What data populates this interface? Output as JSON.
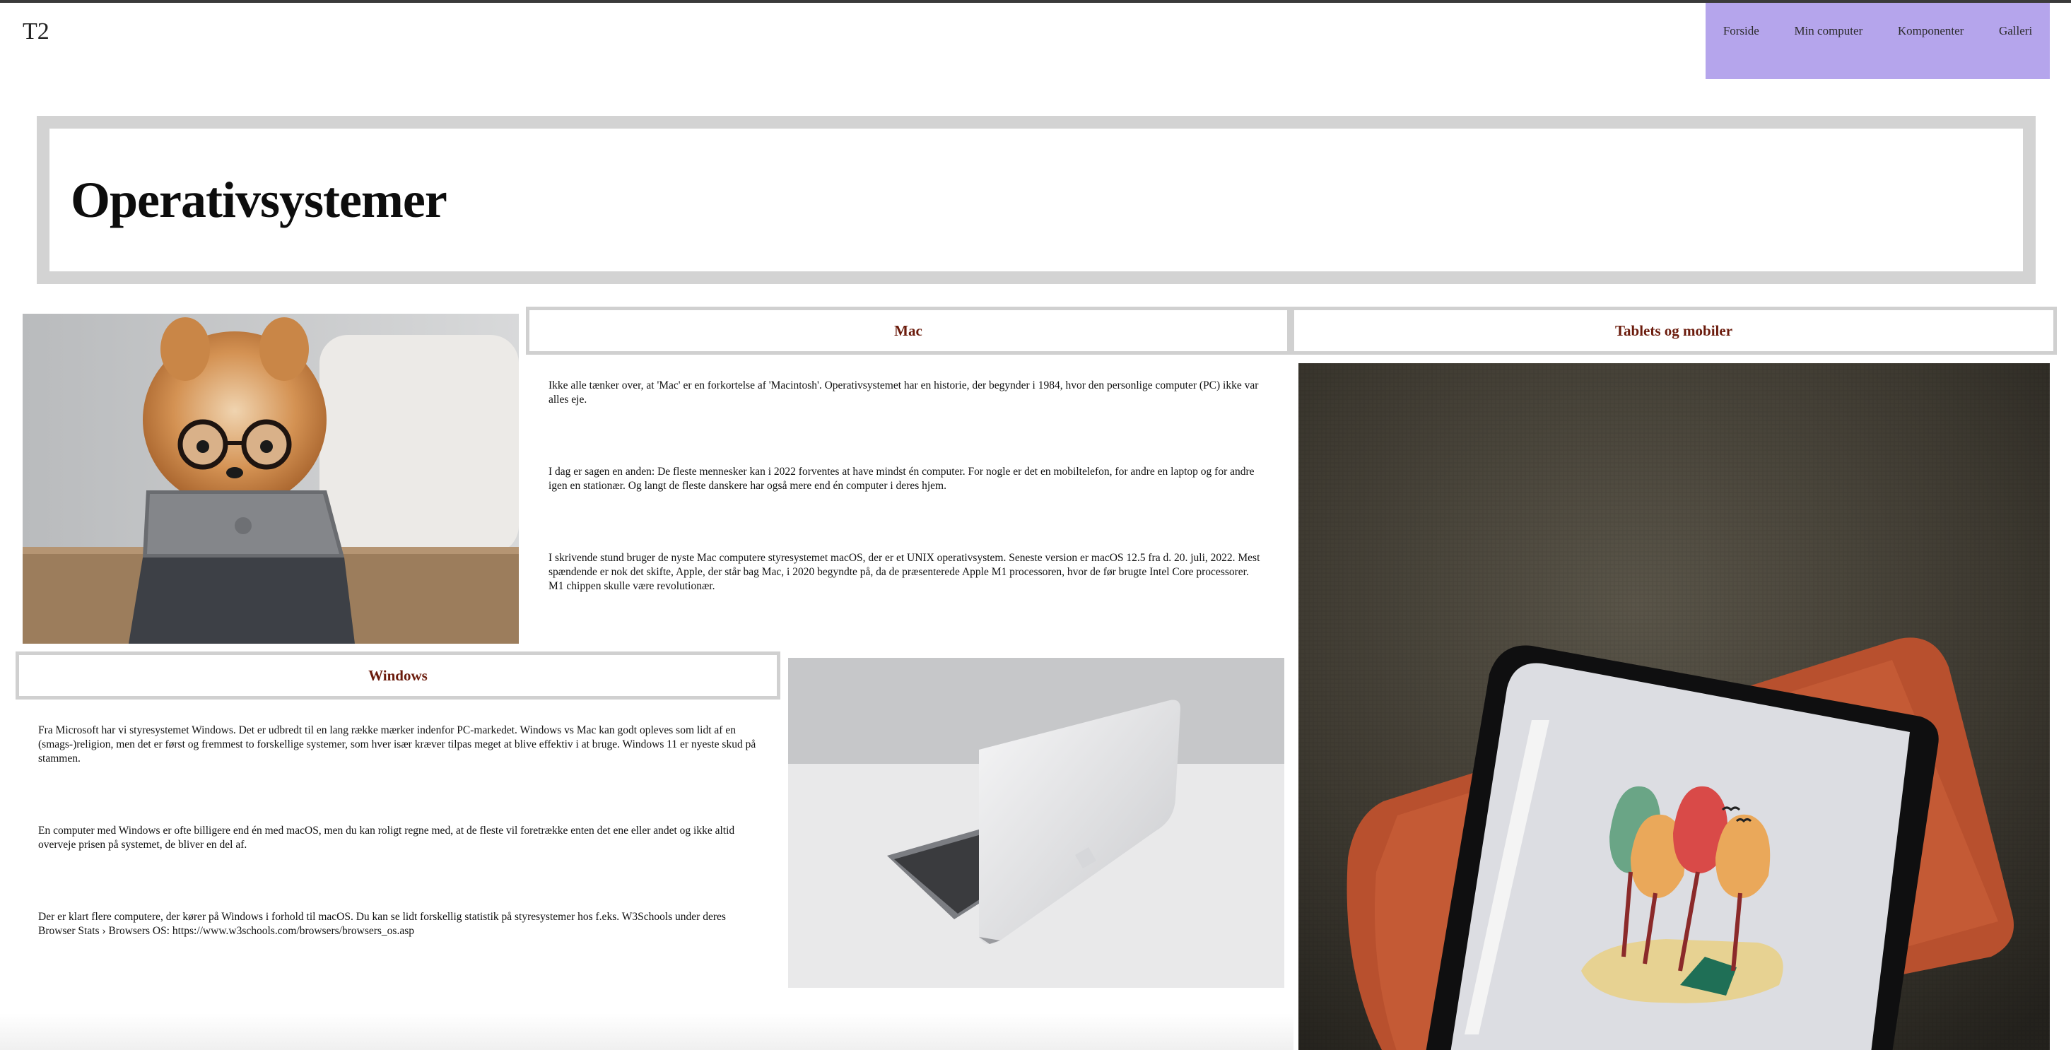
{
  "header": {
    "logo": "T2",
    "nav": [
      "Forside",
      "Min computer",
      "Komponenter",
      "Galleri"
    ]
  },
  "hero": {
    "title": "Operativsystemer"
  },
  "mac": {
    "heading": "Mac",
    "paragraphs": [
      "Ikke alle tænker over, at 'Mac' er en forkortelse af 'Macintosh'. Operativsystemet har en historie, der begynder i 1984, hvor den personlige computer (PC) ikke var alles eje.",
      "I dag er sagen en anden: De fleste mennesker kan i 2022 forventes at have mindst én computer. For nogle er det en mobiltelefon, for andre en laptop og for andre igen en stationær. Og langt de fleste danskere har også mere end én computer i deres hjem.",
      "I skrivende stund bruger de nyste Mac computere styresystemet macOS, der er et UNIX operativsystem. Seneste version er macOS 12.5 fra d. 20. juli, 2022. Mest spændende er nok det skifte, Apple, der står bag Mac, i 2020 begyndte på, da de præsenterede Apple M1 processoren, hvor de før brugte Intel Core processorer. M1 chippen skulle være revolutionær."
    ]
  },
  "tablets": {
    "heading": "Tablets og mobiler"
  },
  "windows": {
    "heading": "Windows",
    "paragraphs": [
      "Fra Microsoft har vi styresystemet Windows. Det er udbredt til en lang række mærker indenfor PC-markedet. Windows vs Mac kan godt opleves som lidt af en (smags-)religion, men det er først og fremmest to forskellige systemer, som hver især kræver tilpas meget at blive effektiv i at bruge. Windows 11 er nyeste skud på stammen.",
      "En computer med Windows er ofte billigere end én med macOS, men du kan roligt regne med, at de fleste vil foretrække enten det ene eller andet og ikke altid overveje prisen på systemet, de bliver en del af.",
      "Der er klart flere computere, der kører på Windows i forhold til macOS. Du kan se lidt forskellig statistik på styresystemer hos f.eks. W3Schools under deres Browser Stats › Browsers OS: https://www.w3schools.com/browsers/browsers_os.asp"
    ]
  },
  "colors": {
    "nav_bg": "#b5a5ec",
    "heading_text": "#6b1b0c",
    "border": "#d0d0d0"
  }
}
